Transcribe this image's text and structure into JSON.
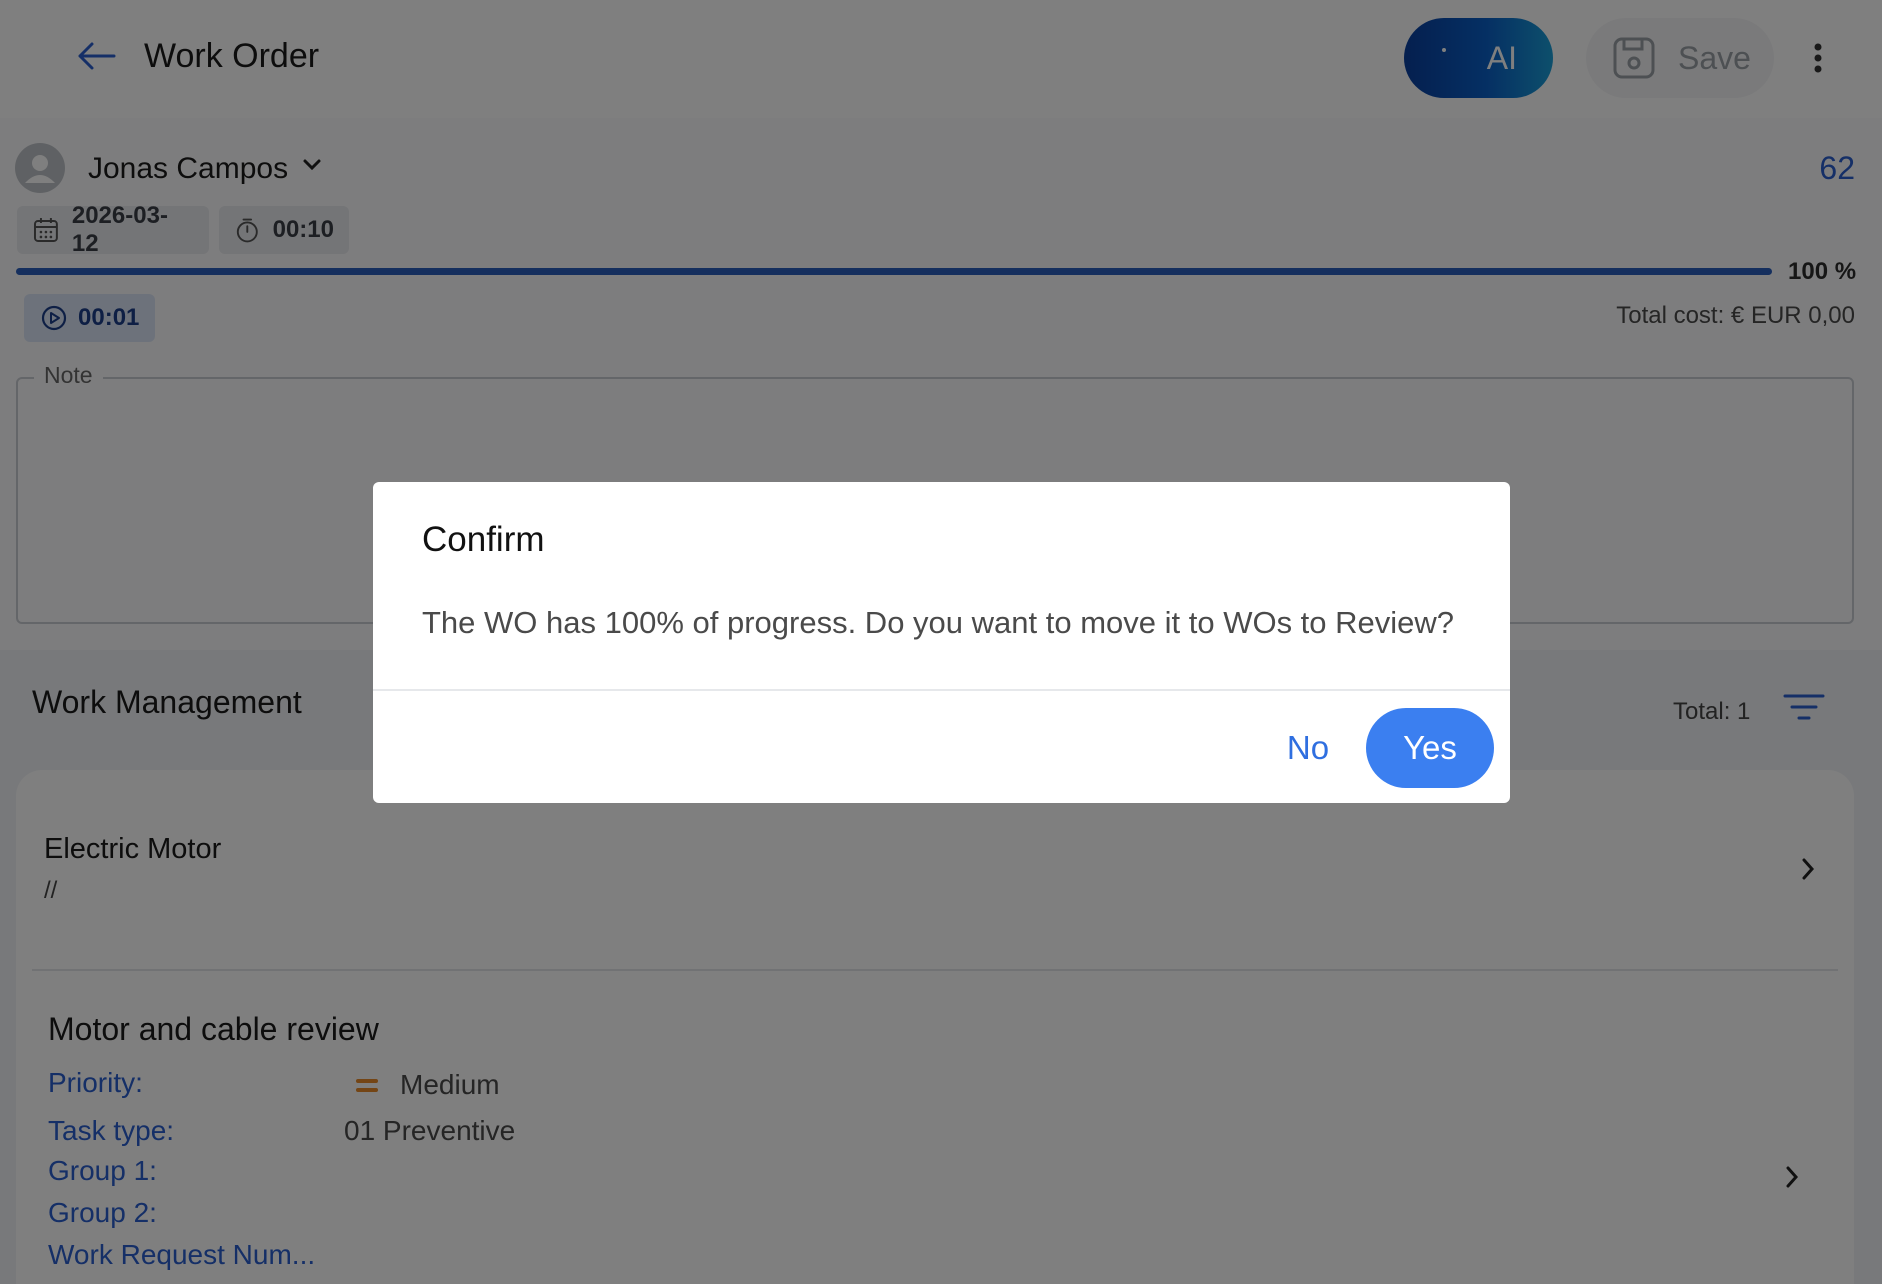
{
  "header": {
    "title": "Work Order",
    "ai_label": "AI",
    "save_label": "Save"
  },
  "work_order": {
    "assignee": "Jonas Campos",
    "number": "62",
    "date": "2026-03-12",
    "duration": "00:10",
    "progress_percent": 100,
    "progress_label": "100 %",
    "timer": "00:01",
    "total_cost": "Total cost: € EUR 0,00",
    "note_label": "Note",
    "note_value": ""
  },
  "work_management": {
    "title": "Work Management",
    "total": "Total: 1",
    "asset": {
      "name": "Electric Motor",
      "path": "//"
    },
    "task": {
      "title": "Motor and cable review",
      "priority_label": "Priority:",
      "priority_value": "Medium",
      "priority_color": "#e88a2a",
      "task_type_label": "Task type:",
      "task_type_value": "01 Preventive",
      "group1_label": "Group 1:",
      "group2_label": "Group 2:",
      "work_request_label": "Work Request Num..."
    }
  },
  "dialog": {
    "title": "Confirm",
    "message": "The WO has 100% of progress. Do you want to move it to WOs to Review?",
    "no_label": "No",
    "yes_label": "Yes"
  },
  "colors": {
    "accent": "#2a5fcf",
    "primary_button": "#3b7ff0",
    "progress": "#2b5fbd"
  }
}
